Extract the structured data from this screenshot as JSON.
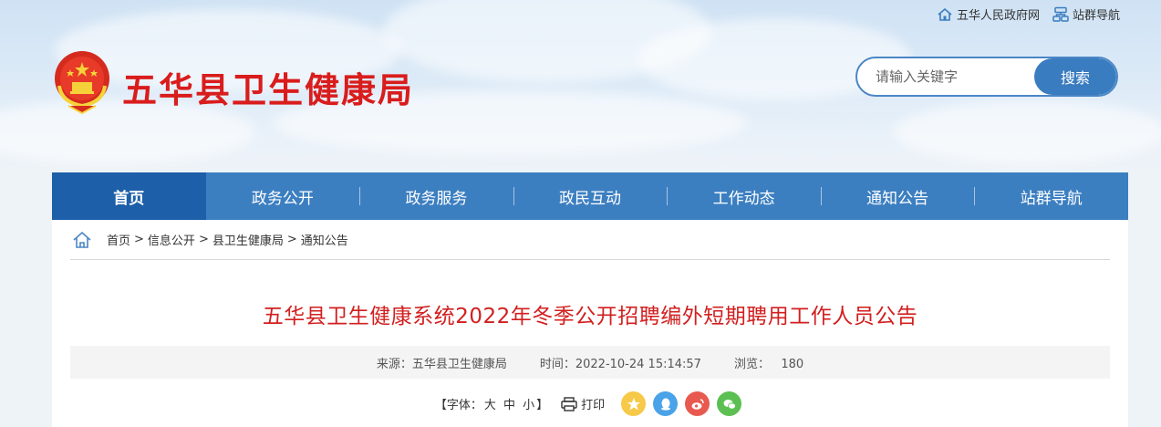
{
  "topbar": {
    "gov_link": "五华人民政府网",
    "site_nav": "站群导航"
  },
  "site": {
    "title": "五华县卫生健康局"
  },
  "search": {
    "placeholder": "请输入关键字",
    "button": "搜索"
  },
  "nav": {
    "items": [
      {
        "label": "首页"
      },
      {
        "label": "政务公开"
      },
      {
        "label": "政务服务"
      },
      {
        "label": "政民互动"
      },
      {
        "label": "工作动态"
      },
      {
        "label": "通知公告"
      },
      {
        "label": "站群导航"
      }
    ]
  },
  "breadcrumb": {
    "items": [
      "首页",
      "信息公开",
      "县卫生健康局",
      "通知公告"
    ],
    "separator": ">"
  },
  "article": {
    "title": "五华县卫生健康系统2022年冬季公开招聘编外短期聘用工作人员公告",
    "source": "来源：五华县卫生健康局",
    "time": "时间：2022-10-24 15:14:57",
    "views": "浏览：   180"
  },
  "tools": {
    "font_prefix": "【字体：",
    "large": "大",
    "medium": "中",
    "small": "小",
    "font_suffix": "】",
    "print": "打印"
  },
  "colors": {
    "nav_bg": "#3c7fc1",
    "nav_active": "#1d5fa8",
    "title_red": "#d21f1f",
    "site_title_red": "#d91c1c"
  }
}
